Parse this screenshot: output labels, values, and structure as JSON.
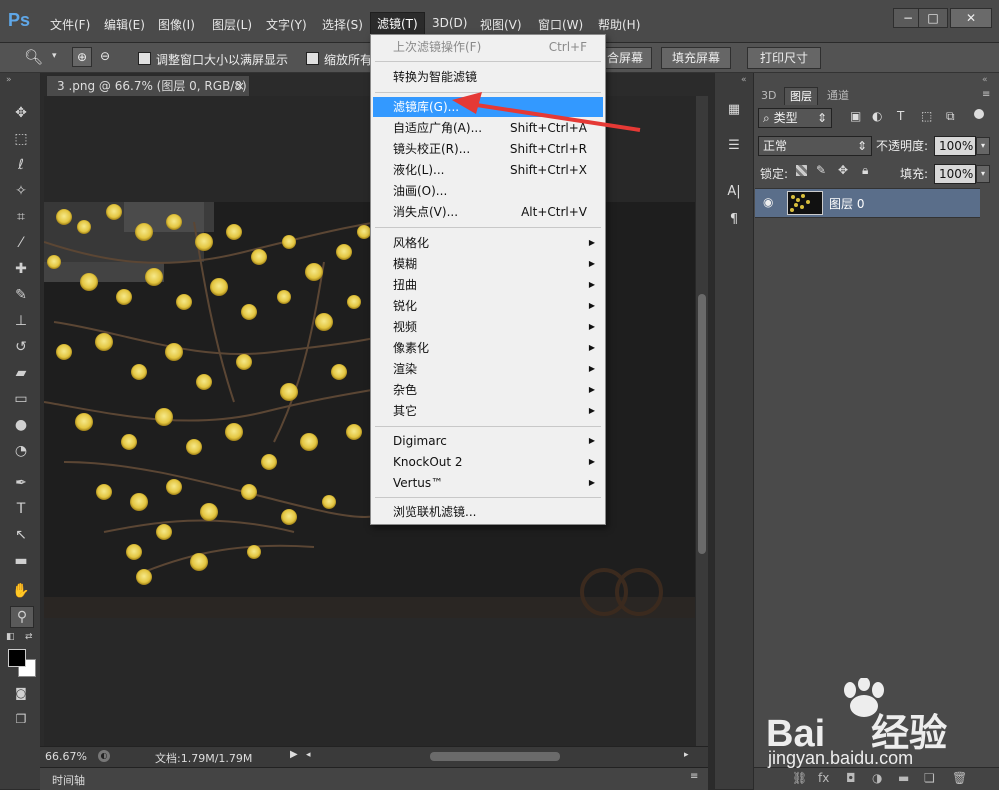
{
  "app": {
    "logo": "Ps"
  },
  "menubar": {
    "items": [
      "文件(F)",
      "编辑(E)",
      "图像(I)",
      "图层(L)",
      "文字(Y)",
      "选择(S)",
      "滤镜(T)",
      "3D(D)",
      "视图(V)",
      "窗口(W)",
      "帮助(H)"
    ],
    "active_index": 6,
    "window_controls": [
      "−",
      "□",
      "✕"
    ]
  },
  "options": {
    "resize_windows": "调整窗口大小以满屏显示",
    "zoom_all": "缩放所有",
    "fit_screen_tail": "合屏幕",
    "fill_screen": "填充屏幕",
    "print_size": "打印尺寸"
  },
  "document": {
    "tab_title": "3 .png @ 66.7% (图层 0, RGB/8)",
    "tab_close": "×",
    "zoom": "66.67%",
    "doc_size": "文档:1.79M/1.79M",
    "timeline": "时间轴"
  },
  "layers_panel": {
    "tabs": [
      "3D",
      "图层",
      "通道"
    ],
    "active_tab": 1,
    "filter_kind": "类型",
    "blend_mode": "正常",
    "opacity_label": "不透明度:",
    "opacity_value": "100%",
    "lock_label": "锁定:",
    "fill_label": "填充:",
    "fill_value": "100%",
    "layer_name": "图层 0"
  },
  "filter_menu": {
    "items": [
      {
        "label": "上次滤镜操作(F)",
        "shortcut": "Ctrl+F",
        "disabled": true
      },
      {
        "label": "转换为智能滤镜"
      },
      {
        "label": "滤镜库(G)...",
        "highlighted": true
      },
      {
        "label": "自适应广角(A)...",
        "shortcut": "Shift+Ctrl+A"
      },
      {
        "label": "镜头校正(R)...",
        "shortcut": "Shift+Ctrl+R"
      },
      {
        "label": "液化(L)...",
        "shortcut": "Shift+Ctrl+X"
      },
      {
        "label": "油画(O)..."
      },
      {
        "label": "消失点(V)...",
        "shortcut": "Alt+Ctrl+V"
      },
      {
        "label": "风格化",
        "submenu": true
      },
      {
        "label": "模糊",
        "submenu": true
      },
      {
        "label": "扭曲",
        "submenu": true
      },
      {
        "label": "锐化",
        "submenu": true
      },
      {
        "label": "视频",
        "submenu": true
      },
      {
        "label": "像素化",
        "submenu": true
      },
      {
        "label": "渲染",
        "submenu": true
      },
      {
        "label": "杂色",
        "submenu": true
      },
      {
        "label": "其它",
        "submenu": true
      },
      {
        "label": "Digimarc",
        "submenu": true
      },
      {
        "label": "KnockOut 2",
        "submenu": true
      },
      {
        "label": "Vertus™",
        "submenu": true
      },
      {
        "label": "浏览联机滤镜..."
      }
    ],
    "arrow_color": "#e53935",
    "highlight_color": "#3399ff"
  },
  "watermark": {
    "brand": "Bai",
    "brand_tail": "经验",
    "url": "jingyan.baidu.com"
  }
}
